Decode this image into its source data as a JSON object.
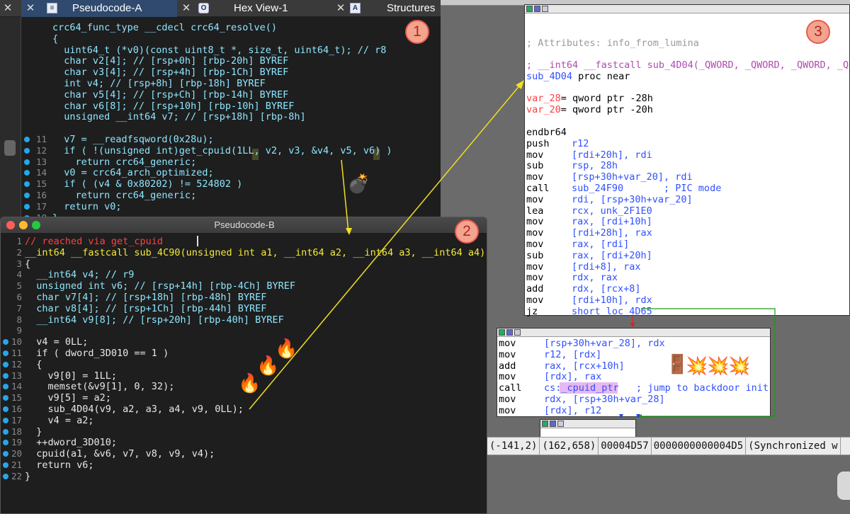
{
  "tabs": [
    {
      "label": "Pseudocode-A"
    },
    {
      "label": "Hex View-1"
    },
    {
      "label": "Structures"
    }
  ],
  "badges": {
    "one": "1",
    "two": "2",
    "three": "3"
  },
  "paneA": {
    "lines": [
      {
        "n": "",
        "t": "crc64_func_type __cdecl crc64_resolve()"
      },
      {
        "n": "",
        "t": "{"
      },
      {
        "n": "",
        "t": "  uint64_t (*v0)(const uint8_t *, size_t, uint64_t); // r8"
      },
      {
        "n": "",
        "t": "  char v2[4]; // [rsp+0h] [rbp-20h] BYREF"
      },
      {
        "n": "",
        "t": "  char v3[4]; // [rsp+4h] [rbp-1Ch] BYREF"
      },
      {
        "n": "",
        "t": "  int v4; // [rsp+8h] [rbp-18h] BYREF"
      },
      {
        "n": "",
        "t": "  char v5[4]; // [rsp+Ch] [rbp-14h] BYREF"
      },
      {
        "n": "",
        "t": "  char v6[8]; // [rsp+10h] [rbp-10h] BYREF"
      },
      {
        "n": "",
        "t": "  unsigned __int64 v7; // [rsp+18h] [rbp-8h]"
      },
      {
        "n": "",
        "t": ""
      },
      {
        "n": "11",
        "t": "  v7 = __readfsqword(0x28u);"
      },
      {
        "n": "12",
        "t": "  if ( !(unsigned int)get_cpuid(1LL, v2, v3, &v4, v5, v6) )"
      },
      {
        "n": "13",
        "t": "    return crc64_generic;"
      },
      {
        "n": "14",
        "t": "  v0 = crc64_arch_optimized;"
      },
      {
        "n": "15",
        "t": "  if ( (v4 & 0x80202) != 524802 )"
      },
      {
        "n": "16",
        "t": "    return crc64_generic;"
      },
      {
        "n": "17",
        "t": "  return v0;"
      },
      {
        "n": "18",
        "t": "}"
      }
    ]
  },
  "paneB": {
    "title": "Pseudocode-B",
    "lines": [
      {
        "n": "1",
        "t": "// reached via get_cpuid"
      },
      {
        "n": "2",
        "t": "__int64 __fastcall sub_4C90(unsigned int a1, __int64 a2, __int64 a3, __int64 a4)"
      },
      {
        "n": "3",
        "t": "{"
      },
      {
        "n": "4",
        "t": "  __int64 v4; // r9"
      },
      {
        "n": "5",
        "t": "  unsigned int v6; // [rsp+14h] [rbp-4Ch] BYREF"
      },
      {
        "n": "6",
        "t": "  char v7[4]; // [rsp+18h] [rbp-48h] BYREF"
      },
      {
        "n": "7",
        "t": "  char v8[4]; // [rsp+1Ch] [rbp-44h] BYREF"
      },
      {
        "n": "8",
        "t": "  __int64 v9[8]; // [rsp+20h] [rbp-40h] BYREF"
      },
      {
        "n": "9",
        "t": ""
      },
      {
        "n": "10",
        "t": "  v4 = 0LL;"
      },
      {
        "n": "11",
        "t": "  if ( dword_3D010 == 1 )"
      },
      {
        "n": "12",
        "t": "  {"
      },
      {
        "n": "13",
        "t": "    v9[0] = 1LL;"
      },
      {
        "n": "14",
        "t": "    memset(&v9[1], 0, 32);"
      },
      {
        "n": "15",
        "t": "    v9[5] = a2;"
      },
      {
        "n": "16",
        "t": "    sub_4D04(v9, a2, a3, a4, v9, 0LL);"
      },
      {
        "n": "17",
        "t": "    v4 = a2;"
      },
      {
        "n": "18",
        "t": "  }"
      },
      {
        "n": "19",
        "t": "  ++dword_3D010;"
      },
      {
        "n": "20",
        "t": "  cpuid(a1, &v6, v7, v8, v9, v4);"
      },
      {
        "n": "21",
        "t": "  return v6;"
      },
      {
        "n": "22",
        "t": "}"
      }
    ]
  },
  "box3": {
    "attr": "; Attributes: info_from_lumina",
    "proto": "; __int64 __fastcall sub_4D04(_QWORD, _QWORD, _QWORD, _Q",
    "proc": "sub_4D04 proc near",
    "var28": "var_28= qword ptr -28h",
    "var20": "var_20= qword ptr -20h",
    "asm": [
      {
        "op": "endbr64",
        "arg": ""
      },
      {
        "op": "push",
        "arg": "r12"
      },
      {
        "op": "mov",
        "arg": "[rdi+20h], rdi"
      },
      {
        "op": "sub",
        "arg": "rsp, 28h"
      },
      {
        "op": "mov",
        "arg": "[rsp+30h+var_20], rdi"
      },
      {
        "op": "call",
        "arg": "sub_24F90       ; PIC mode"
      },
      {
        "op": "mov",
        "arg": "rdi, [rsp+30h+var_20]"
      },
      {
        "op": "lea",
        "arg": "rcx, unk_2F1E0"
      },
      {
        "op": "mov",
        "arg": "rax, [rdi+10h]"
      },
      {
        "op": "mov",
        "arg": "[rdi+28h], rax"
      },
      {
        "op": "mov",
        "arg": "rax, [rdi]"
      },
      {
        "op": "sub",
        "arg": "rax, [rdi+20h]"
      },
      {
        "op": "mov",
        "arg": "[rdi+8], rax"
      },
      {
        "op": "mov",
        "arg": "rdx, rax"
      },
      {
        "op": "add",
        "arg": "rdx, [rcx+8]"
      },
      {
        "op": "mov",
        "arg": "[rdi+10h], rdx"
      },
      {
        "op": "jz",
        "arg": "short loc_4D65"
      }
    ]
  },
  "box4": {
    "asm": [
      {
        "op": "mov",
        "arg": "[rsp+30h+var_28], rdx"
      },
      {
        "op": "mov",
        "arg": "r12, [rdx]"
      },
      {
        "op": "add",
        "arg": "rax, [rcx+10h]"
      },
      {
        "op": "mov",
        "arg": "[rdx], rax"
      },
      {
        "op": "call",
        "arg": "cs:_cpuid_ptr   ; jump to backdoor init"
      },
      {
        "op": "mov",
        "arg": "rdx, [rsp+30h+var_28]"
      },
      {
        "op": "mov",
        "arg": "[rdx], r12"
      }
    ]
  },
  "status": {
    "a": "(-141,2)",
    "b": "(162,658)",
    "c": "00004D57",
    "d": "0000000000004D5",
    "e": "(Synchronized w"
  },
  "emojis": {
    "bomb": "💣",
    "fire": "🔥",
    "door": "🚪",
    "boom": "💥"
  }
}
